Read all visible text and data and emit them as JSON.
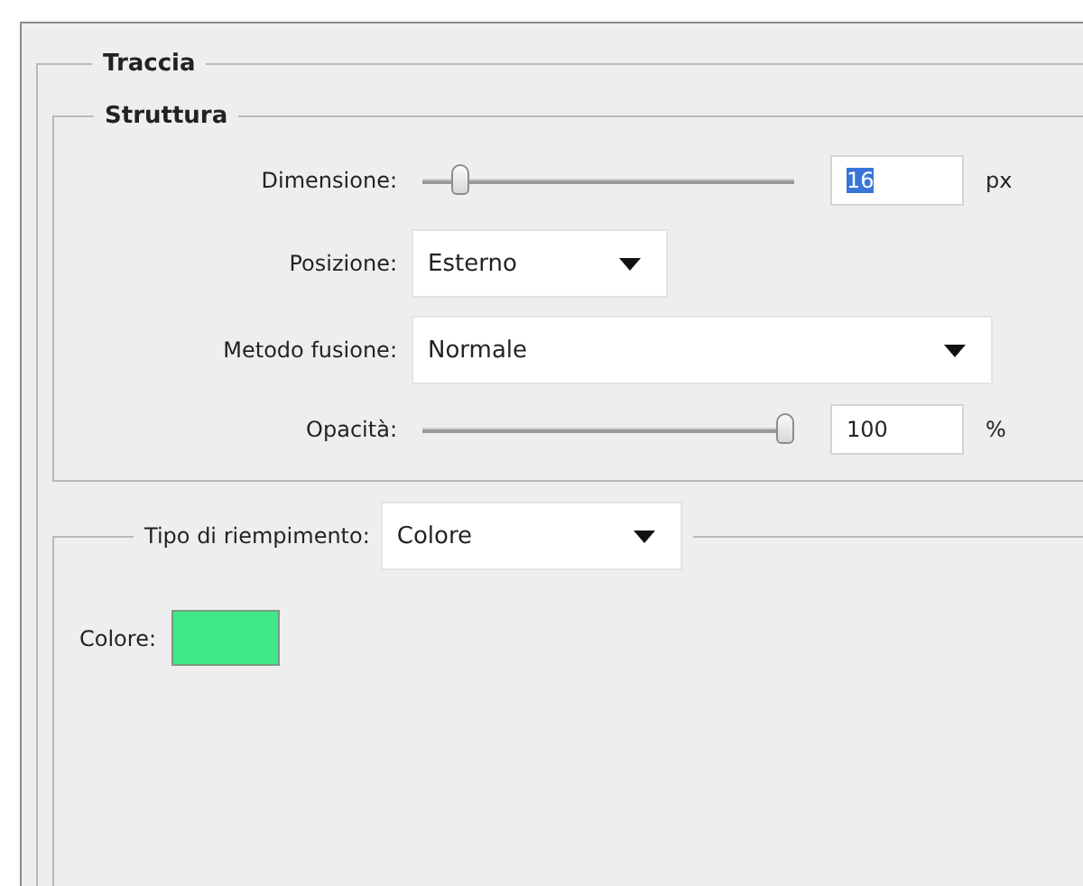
{
  "stroke_group": {
    "title": "Traccia"
  },
  "structure_group": {
    "title": "Struttura",
    "rows": [
      {
        "kind": "slider",
        "label": "Dimensione:",
        "level": 0.08,
        "value": "16",
        "value_highlighted": true,
        "unit": "px"
      },
      {
        "kind": "dropdown",
        "label": "Posizione:",
        "value": "Esterno"
      },
      {
        "kind": "dropdown",
        "label": "Metodo fusione:",
        "value": "Normale"
      },
      {
        "kind": "slider",
        "label": "Opacità:",
        "level": 1,
        "value": "100",
        "value_highlighted": false,
        "unit": "%"
      }
    ]
  },
  "fill_group": {
    "label": "Tipo di riempimento:",
    "value": "Colore",
    "color_label": "Colore:",
    "color": "#3ee886"
  }
}
